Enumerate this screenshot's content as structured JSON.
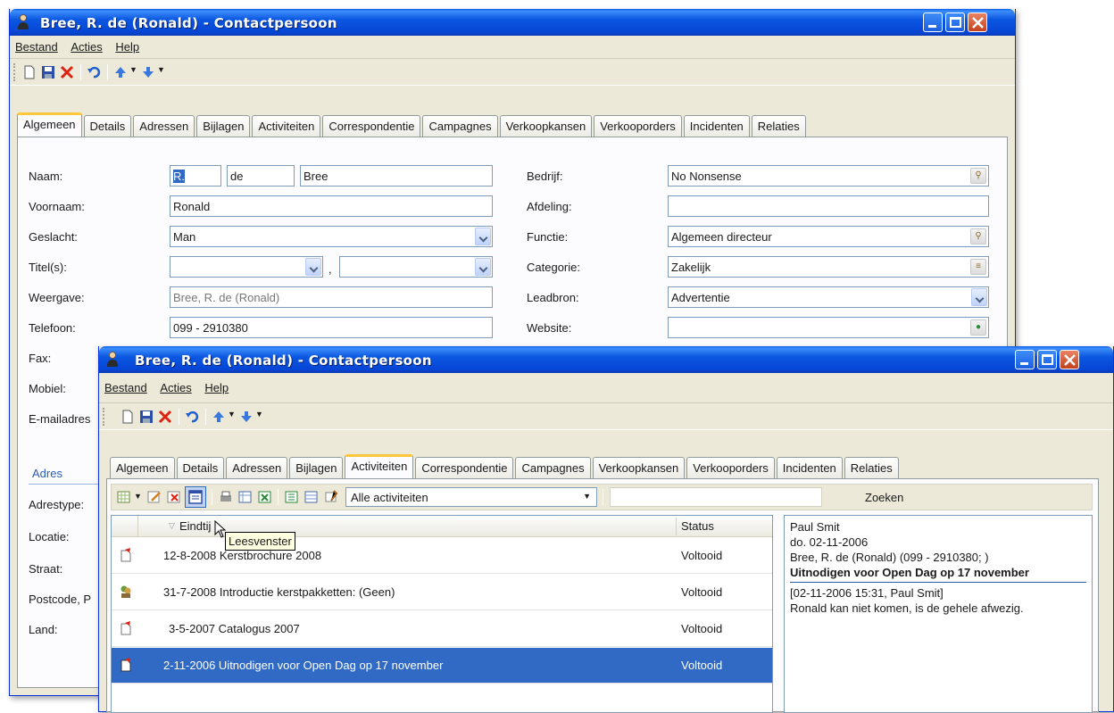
{
  "back_window": {
    "title": "Bree, R. de (Ronald) - Contactpersoon",
    "menu": [
      "Bestand",
      "Acties",
      "Help"
    ],
    "tabs": [
      "Algemeen",
      "Details",
      "Adressen",
      "Bijlagen",
      "Activiteiten",
      "Correspondentie",
      "Campagnes",
      "Verkoopkansen",
      "Verkooporders",
      "Incidenten",
      "Relaties"
    ],
    "active_tab": "Algemeen",
    "left_labels": {
      "naam": "Naam:",
      "voornaam": "Voornaam:",
      "geslacht": "Geslacht:",
      "titels": "Titel(s):",
      "weergave": "Weergave:",
      "telefoon": "Telefoon:",
      "fax": "Fax:",
      "mobiel": "Mobiel:",
      "email": "E-mailadres"
    },
    "values": {
      "voorletters": "R.",
      "tussenvoegsel": "de",
      "achternaam": "Bree",
      "voornaam": "Ronald",
      "geslacht": "Man",
      "titel_sep": ",",
      "weergave": "Bree, R. de (Ronald)",
      "telefoon": "099 - 2910380"
    },
    "right_labels": {
      "bedrijf": "Bedrijf:",
      "afdeling": "Afdeling:",
      "functie": "Functie:",
      "categorie": "Categorie:",
      "leadbron": "Leadbron:",
      "website": "Website:"
    },
    "right_values": {
      "bedrijf": "No Nonsense",
      "afdeling": "",
      "functie": "Algemeen directeur",
      "categorie": "Zakelijk",
      "leadbron": "Advertentie",
      "website": ""
    },
    "address": {
      "section_title": "Adres",
      "labels": [
        "Adrestype:",
        "Locatie:",
        "Straat:",
        "Postcode, P",
        "Land:"
      ]
    }
  },
  "front_window": {
    "title": "Bree, R. de (Ronald) - Contactpersoon",
    "menu": [
      "Bestand",
      "Acties",
      "Help"
    ],
    "tabs": [
      "Algemeen",
      "Details",
      "Adressen",
      "Bijlagen",
      "Activiteiten",
      "Correspondentie",
      "Campagnes",
      "Verkoopkansen",
      "Verkooporders",
      "Incidenten",
      "Relaties"
    ],
    "active_tab": "Activiteiten",
    "filter": "Alle activiteiten",
    "search_value": "",
    "search_button": "Zoeken",
    "tooltip": "Leesvenster",
    "columns": {
      "date": "Eindtij",
      "status": "Status"
    },
    "rows": [
      {
        "description": "12-8-2008 Kerstbrochure 2008",
        "status": "Voltooid",
        "icon": "mail-icon",
        "selected": false
      },
      {
        "description": "31-7-2008 Introductie kerstpakketten: (Geen)",
        "status": "Voltooid",
        "icon": "meeting-icon",
        "selected": false
      },
      {
        "description": "3-5-2007 Catalogus 2007",
        "status": "Voltooid",
        "icon": "mail-icon",
        "selected": false
      },
      {
        "description": "2-11-2006 Uitnodigen voor Open Dag op 17 november",
        "status": "Voltooid",
        "icon": "mail-icon",
        "selected": true
      }
    ],
    "reading_pane": {
      "from": "Paul Smit",
      "date": "do. 02-11-2006",
      "contact": "Bree, R. de (Ronald) (099 - 2910380; )",
      "subject": "Uitnodigen voor Open Dag op 17 november",
      "note_header": "[02-11-2006 15:31, Paul Smit]",
      "note_body": "Ronald kan niet komen, is de gehele afwezig."
    }
  },
  "colors": {
    "titlebar": "#0a5ce8",
    "selection": "#316ac5",
    "tab_highlight": "#ffc83c"
  }
}
